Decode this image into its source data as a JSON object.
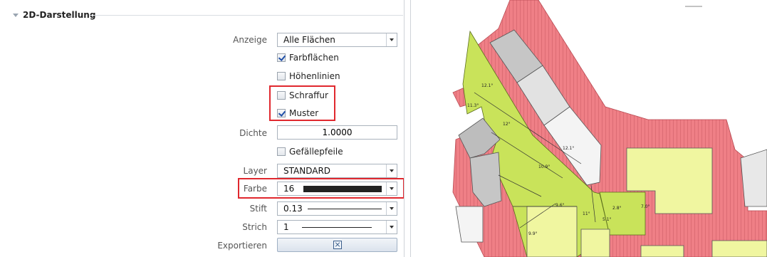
{
  "section": {
    "title": "2D-Darstellung"
  },
  "fields": {
    "anzeige": {
      "label": "Anzeige",
      "value": "Alle Flächen"
    },
    "farbflaechen": {
      "label": "Farbflächen",
      "checked": true
    },
    "hoehenlinien": {
      "label": "Höhenlinien",
      "checked": false
    },
    "schraffur": {
      "label": "Schraffur",
      "checked": false
    },
    "muster": {
      "label": "Muster",
      "checked": true
    },
    "dichte": {
      "label": "Dichte",
      "value": "1.0000"
    },
    "gefaellepfeile": {
      "label": "Gefällepfeile",
      "checked": false
    },
    "layer": {
      "label": "Layer",
      "value": "STANDARD"
    },
    "farbe": {
      "label": "Farbe",
      "value": "16",
      "swatch": "#222222"
    },
    "stift": {
      "label": "Stift",
      "value": "0.13"
    },
    "strich": {
      "label": "Strich",
      "value": "1"
    },
    "exportieren": {
      "label": "Exportieren"
    }
  },
  "colors": {
    "highlight": "#e0282e",
    "roof_red": "#ef7f86",
    "roof_green": "#c9e35a",
    "roof_yellow": "#f0f6a0",
    "roof_grey": "#c6c6c6"
  },
  "drawing": {
    "labels": [
      "11.3°",
      "12.1°",
      "12°",
      "12.1°",
      "10.9°",
      "9.6°",
      "11°",
      "2.8°",
      "5.1°",
      "9.9°",
      "7.0°"
    ]
  }
}
